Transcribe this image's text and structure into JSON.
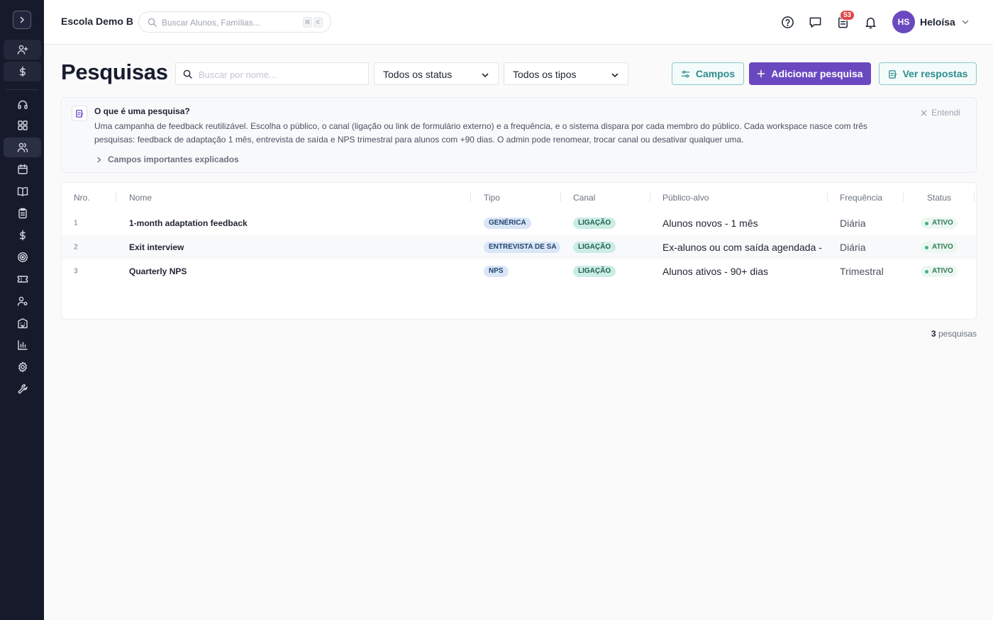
{
  "header": {
    "school": "Escola Demo B",
    "search_placeholder": "Buscar Alunos, Famílias...",
    "kbd_1": "⌘",
    "kbd_2": "K",
    "badge_count": "53",
    "avatar_initials": "HS",
    "user_name": "Heloísa"
  },
  "page": {
    "title": "Pesquisas",
    "search_placeholder": "Buscar por nome...",
    "status_filter": "Todos os status",
    "type_filter": "Todos os tipos",
    "fields_button": "Campos",
    "add_button": "Adicionar pesquisa",
    "responses_button": "Ver respostas"
  },
  "info": {
    "title": "O que é uma pesquisa?",
    "text": "Uma campanha de feedback reutilizável. Escolha o público, o canal (ligação ou link de formulário externo) e a frequência, e o sistema dispara por cada membro do público. Cada workspace nasce com três pesquisas: feedback de adaptação 1 mês, entrevista de saída e NPS trimestral para alunos com +90 dias. O admin pode renomear, trocar canal ou desativar qualquer uma.",
    "dismiss": "Entendi",
    "expand": "Campos importantes explicados"
  },
  "table": {
    "headers": [
      "Nro.",
      "Nome",
      "Tipo",
      "Canal",
      "Público-alvo",
      "Frequência",
      "Status"
    ],
    "rows": [
      {
        "nro": "1",
        "nome": "1-month adaptation feedback",
        "tipo": "GENÉRICA",
        "canal": "LIGAÇÃO",
        "publico": "Alunos novos - 1 mês",
        "freq": "Diária",
        "status": "ATIVO"
      },
      {
        "nro": "2",
        "nome": "Exit interview",
        "tipo": "ENTREVISTA DE SA",
        "canal": "LIGAÇÃO",
        "publico": "Ex-alunos ou com saída agendada -",
        "freq": "Diária",
        "status": "ATIVO"
      },
      {
        "nro": "3",
        "nome": "Quarterly NPS",
        "tipo": "NPS",
        "canal": "LIGAÇÃO",
        "publico": "Alunos ativos - 90+ dias",
        "freq": "Trimestral",
        "status": "ATIVO"
      }
    ]
  },
  "footer": {
    "count": "3",
    "label": "pesquisas"
  },
  "colors": {
    "sidebar": "#161a2b",
    "primary": "#6a49c0",
    "teal": "#2f8c8c",
    "badge": "#e04545"
  },
  "sidebar": {
    "icons": [
      "user-plus-icon",
      "dollar-icon",
      "headset-icon",
      "grid-icon",
      "users-icon",
      "calendar-icon",
      "book-icon",
      "clipboard-icon",
      "dollar-icon",
      "target-icon",
      "ticket-icon",
      "user-gear-icon",
      "building-icon",
      "bar-chart-icon",
      "gear-icon",
      "wrench-icon"
    ]
  }
}
